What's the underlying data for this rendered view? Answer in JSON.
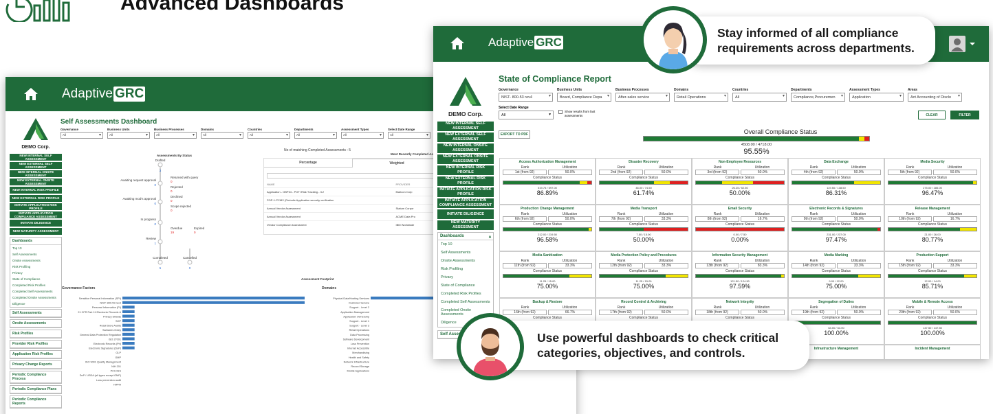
{
  "header": {
    "title": "Advanced Dashboards"
  },
  "brand": {
    "name_prefix": "Adaptive",
    "name_suffix": "GRC"
  },
  "company": "DEMO Corp.",
  "back_window": {
    "title": "Self Assessments Dashboard",
    "filters": [
      {
        "label": "Governance",
        "value": "All"
      },
      {
        "label": "Business Units",
        "value": "All"
      },
      {
        "label": "Business Processes",
        "value": "All"
      },
      {
        "label": "Domains",
        "value": "All"
      },
      {
        "label": "Countries",
        "value": "All"
      },
      {
        "label": "Departments",
        "value": "All"
      },
      {
        "label": "Assessment Types",
        "value": "All"
      },
      {
        "label": "Select Date Range",
        "value": "All"
      }
    ],
    "nav_buttons": [
      "NEW INTERNAL SELF ASSESSMENT",
      "NEW EXTERNAL SELF ASSESSMENT",
      "NEW INTERNAL ONSITE ASSESSMENT",
      "NEW EXTERNAL ONSITE ASSESSMENT",
      "NEW INTERNAL RISK PROFILE",
      "NEW EXTERNAL RISK PROFILE",
      "INITIATE APPLICATION RISK PROFILE",
      "INITIATE APPLICATION COMPLIANCE ASSESSMENT",
      "INITIATE DILIGENCE",
      "NEW MATURITY ASSESSMENT"
    ],
    "dashboards_head": "Dashboards",
    "dashboard_links": [
      "Top 10",
      "Self Assessments",
      "Onsite Assessments",
      "Risk Profiling",
      "Privacy",
      "State of Compliance",
      "Completed Risk Profiles",
      "Completed Self Assessments",
      "Completed Onsite Assessments",
      "Diligence"
    ],
    "other_heads": [
      "Self Assessments",
      "Onsite Assessments",
      "Risk Profiles",
      "Provider Risk Profiles",
      "Application Risk Profiles",
      "Privacy Change Reports",
      "Periodic Compliance Process",
      "Periodic Compliance Plans",
      "Periodic Compliance Reports"
    ],
    "flow": {
      "title": "Assessments By Status",
      "nodes": [
        {
          "label": "Drafted",
          "count": "3"
        },
        {
          "label": "Awaiting request approval",
          "count": "0"
        },
        {
          "label": "Returned with query",
          "count": "0"
        },
        {
          "label": "Rejected",
          "count": "0"
        },
        {
          "label": "Awaiting mod's approval",
          "count": "0"
        },
        {
          "label": "Declined",
          "count": "0"
        },
        {
          "label": "Scope rejected",
          "count": "0"
        },
        {
          "label": "In progress",
          "count": "0"
        },
        {
          "label": "Overdue",
          "count": "19"
        },
        {
          "label": "Expired",
          "count": "0"
        },
        {
          "label": "Review",
          "count": "1"
        },
        {
          "label": "Completed",
          "count": "5"
        },
        {
          "label": "Cancelled",
          "count": "0"
        }
      ]
    },
    "recent_title": "Most Recently Completed Assessments",
    "matching_text": "No of matching Completed Assessments : 5",
    "recent_tabs": [
      "Percentage",
      "Weighted"
    ],
    "recent_cols": [
      "NAME",
      "PROVIDER"
    ],
    "recent_rows": [
      {
        "name": "Application - OBP34 - POTI Risk Tracking - 3.2",
        "provider": "Maricon Corp"
      },
      {
        "name": "POP-1-PCMV (Periodic Application security verification",
        "provider": ""
      },
      {
        "name": "Annual Vendor Assessment",
        "provider": "Statum Corpor"
      },
      {
        "name": "Annual Vendor Assessment",
        "provider": "ACME Data Pro"
      },
      {
        "name": "Vendor Compliance Assessment",
        "provider": "IBM Worldwide"
      }
    ],
    "footprint_title": "Assessment Footprint",
    "gov_title": "Governance Factors",
    "gov_items": [
      "Sensitive Personal Information (SPI)",
      "NIST: 800-53 rev4",
      "Personal Information (PI)",
      "21 CFR Part 11 Electronic Records &",
      "Privacy Shields",
      "SOP",
      "Retail Store Audits",
      "Sarbanes Oxley",
      "General Data Protection Regulation",
      "ISO 27001",
      "Electronic Records (Prl)",
      "Electronic Signatures (DoP)",
      "GLP",
      "GMP",
      "ISO 9001 Quality Management",
      "NIH 201",
      "PCI-DSS",
      "DoP / USDA (all types except GMP)",
      "Loss prevention audit",
      "HIPPA"
    ],
    "gov_values": [
      30,
      30,
      2,
      2,
      2,
      2,
      2,
      2,
      2,
      2,
      2,
      2,
      0,
      0,
      0,
      0,
      0,
      0,
      0,
      0
    ],
    "dom_title": "Domains",
    "dom_items": [
      "Physical Data/Hosting Services",
      "Customer Service",
      "Support - Level 2",
      "Application Management",
      "Application Ownership",
      "Support - Level 1",
      "Support - Level 3",
      "Retail Operations",
      "Data Processing",
      "Software Development",
      "Loss Prevention",
      "Internet Accessible",
      "Merchandising",
      "Health and Safety",
      "Network Infrastructure",
      "Record Storage",
      "Mobile Applications"
    ],
    "dom_values": [
      20,
      0,
      0,
      0,
      0,
      0,
      0,
      0,
      0,
      0,
      0,
      0,
      0,
      0,
      0,
      0,
      0
    ]
  },
  "front_window": {
    "title": "State of Compliance Report",
    "filters": [
      {
        "label": "Governance",
        "value": "NIST- 800-53 rev4"
      },
      {
        "label": "Business Units",
        "value": "Board, Compliance Depa"
      },
      {
        "label": "Business Processes",
        "value": "After-sales service"
      },
      {
        "label": "Domains",
        "value": "Retail Operations"
      },
      {
        "label": "Countries",
        "value": "All"
      },
      {
        "label": "Departments",
        "value": "Compliance,Procuremen"
      },
      {
        "label": "Assessment Types",
        "value": "Application"
      },
      {
        "label": "Areas",
        "value": "Act Accounting of Disclo"
      }
    ],
    "date_range_label": "Select Date Range",
    "date_range_value": "All",
    "show_last_label": "Show results from last assessments",
    "clear_label": "CLEAR",
    "filter_label": "FILTER",
    "export_label": "EXPORT TO PDF",
    "overall_title": "Overall Compliance Status",
    "overall_frac": "4508.00 / 4718.00",
    "overall_pct": "95.55%",
    "overall_split": [
      0.955,
      0.025,
      0.02
    ],
    "nav_buttons": [
      "NEW INTERNAL SELF ASSESSMENT",
      "NEW EXTERNAL SELF ASSESSMENT",
      "NEW INTERNAL ONSITE ASSESSMENT",
      "NEW EXTERNAL ONSITE ASSESSMENT",
      "NEW INTERNAL RISK PROFILE",
      "NEW EXTERNAL RISK PROFILE",
      "INITIATE APPLICATION RISK PROFILE",
      "INITIATE APPLICATION COMPLIANCE ASSESSMENT",
      "INITIATE DILIGENCE",
      "NEW MATURITY ASSESSMENT"
    ],
    "dashboards_head": "Dashboards",
    "dashboard_links": [
      "Top 10",
      "Self Assessments",
      "Onsite Assessments",
      "Risk Profiling",
      "Privacy",
      "State of Compliance",
      "Completed Risk Profiles",
      "Completed Self Assessments",
      "Completed Onsite Assessments",
      "Diligence"
    ],
    "self_head": "Self Assessments",
    "tile_labels": {
      "rank": "Rank",
      "util": "Utilization",
      "cs": "Compliance Status"
    },
    "tiles": [
      {
        "name": "Access Authorization Management",
        "rank": "1st (from 92)",
        "util": "50.0%",
        "frac": "519.75 / 597.00",
        "pct": "86.89%",
        "split": [
          0.87,
          0.08,
          0.05
        ]
      },
      {
        "name": "Disaster Recovery",
        "rank": "2nd (from 92)",
        "util": "50.0%",
        "frac": "46.00 / 74.50",
        "pct": "61.74%",
        "split": [
          0.62,
          0.18,
          0.2
        ]
      },
      {
        "name": "Non-Employee Resources",
        "rank": "3rd (from 92)",
        "util": "50.0%",
        "frac": "26.25 / 52.50",
        "pct": "50.00%",
        "split": [
          0.3,
          0.35,
          0.35
        ]
      },
      {
        "name": "Data Exchange",
        "rank": "4th (from 92)",
        "util": "50.0%",
        "frac": "119.50 / 138.50",
        "pct": "86.31%",
        "split": [
          0.7,
          0.3,
          0.0
        ]
      },
      {
        "name": "Media Security",
        "rank": "5th (from 92)",
        "util": "50.0%",
        "frac": "275.00 / 285.00",
        "pct": "96.47%",
        "split": [
          0.96,
          0.04,
          0.0
        ]
      },
      {
        "name": "Production Change Management",
        "rank": "6th (from 92)",
        "util": "50.0%",
        "frac": "212.00 / 219.50",
        "pct": "96.58%",
        "split": [
          0.97,
          0.03,
          0.0
        ]
      },
      {
        "name": "Media Transport",
        "rank": "7th (from 92)",
        "util": "33.3%",
        "frac": "7.50 / 15.00",
        "pct": "50.00%",
        "split": [
          0.5,
          0.0,
          0.5
        ]
      },
      {
        "name": "Email Security",
        "rank": "8th (from 92)",
        "util": "16.7%",
        "frac": "0.00 / 7.50",
        "pct": "0.00%",
        "split": [
          0.0,
          0.0,
          1.0
        ]
      },
      {
        "name": "Electronic Records & Signatures",
        "rank": "9th (from 92)",
        "util": "50.0%",
        "frac": "231.00 / 237.00",
        "pct": "97.47%",
        "split": [
          0.97,
          0.0,
          0.03
        ]
      },
      {
        "name": "Release Management",
        "rank": "10th (from 92)",
        "util": "16.7%",
        "frac": "21.00 / 26.00",
        "pct": "80.77%",
        "split": [
          0.81,
          0.19,
          0.0
        ]
      },
      {
        "name": "Media Sanitization",
        "rank": "11th (from 92)",
        "util": "33.3%",
        "frac": "11.25 / 15.00",
        "pct": "75.00%",
        "split": [
          0.75,
          0.25,
          0.0
        ]
      },
      {
        "name": "Media Protection Policy and Procedures",
        "rank": "12th (from 92)",
        "util": "33.3%",
        "frac": "11.25 / 15.00",
        "pct": "75.00%",
        "split": [
          0.75,
          0.25,
          0.0
        ]
      },
      {
        "name": "Information Security Management",
        "rank": "13th (from 92)",
        "util": "83.3%",
        "frac": "121.50 / 124.50",
        "pct": "97.59%",
        "split": [
          0.97,
          0.03,
          0.0
        ]
      },
      {
        "name": "Media Marking",
        "rank": "14th (from 92)",
        "util": "33.3%",
        "frac": "9.00 / 12.00",
        "pct": "75.00%",
        "split": [
          0.75,
          0.25,
          0.0
        ]
      },
      {
        "name": "Production Support",
        "rank": "15th (from 92)",
        "util": "33.3%",
        "frac": "12.00 / 14.00",
        "pct": "85.71%",
        "split": [
          0.86,
          0.14,
          0.0
        ]
      },
      {
        "name": "Backup & Restore",
        "rank": "16th (from 92)",
        "util": "66.7%",
        "frac": "",
        "pct": "",
        "split": [
          0.9,
          0.1,
          0.0
        ]
      },
      {
        "name": "Record Control & Archiving",
        "rank": "17th (from 92)",
        "util": "50.0%",
        "frac": "",
        "pct": "",
        "split": [
          0.9,
          0.1,
          0.0
        ]
      },
      {
        "name": "Network Integrity",
        "rank": "18th (from 92)",
        "util": "50.0%",
        "frac": "",
        "pct": "",
        "split": [
          0.9,
          0.1,
          0.0
        ]
      },
      {
        "name": "Segregation of Duties",
        "rank": "19th (from 92)",
        "util": "50.0%",
        "frac": "64.00 / 64.00",
        "pct": "100.00%",
        "split": [
          1.0,
          0.0,
          0.0
        ]
      },
      {
        "name": "Mobile & Remote Access",
        "rank": "20th (from 92)",
        "util": "50.0%",
        "frac": "147.50 / 147.50",
        "pct": "100.00%",
        "split": [
          1.0,
          0.0,
          0.0
        ]
      },
      {
        "name": "",
        "rank": "",
        "util": "",
        "frac": "",
        "pct": "",
        "split": [
          0,
          0,
          0
        ]
      },
      {
        "name": "",
        "rank": "",
        "util": "",
        "frac": "",
        "pct": "",
        "split": [
          0,
          0,
          0
        ]
      },
      {
        "name": "",
        "rank": "",
        "util": "",
        "frac": "",
        "pct": "",
        "split": [
          0,
          0,
          0
        ]
      },
      {
        "name": "Infrastructure Management",
        "rank": "",
        "util": "",
        "frac": "",
        "pct": "",
        "split": [
          0,
          0,
          0
        ]
      },
      {
        "name": "Incident Management",
        "rank": "",
        "util": "",
        "frac": "",
        "pct": "",
        "split": [
          0,
          0,
          0
        ]
      }
    ]
  },
  "callouts": {
    "top": "Stay informed of all compliance requirements across departments.",
    "bottom": "Use powerful dashboards to check critical categories, objectives, and controls."
  },
  "colors": {
    "brand_green": "#1f6b3a",
    "compliant": "#1e7a34",
    "partial": "#f2e600",
    "noncompliant": "#e02020"
  }
}
